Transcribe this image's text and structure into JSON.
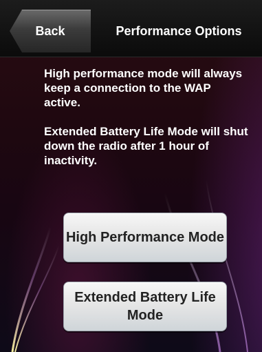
{
  "header": {
    "back_label": "Back",
    "title": "Performance Options"
  },
  "info": {
    "paragraph1": "High performance mode will always keep a connection to the WAP active.",
    "paragraph2": "Extended Battery Life Mode will shut down the radio after 1 hour of inactivity."
  },
  "buttons": {
    "high_performance": "High Performance Mode",
    "extended_battery": "Extended Battery Life Mode"
  },
  "colors": {
    "text": "#ffffff",
    "button_text": "#222222",
    "accent_streak": "#f2e36a"
  }
}
